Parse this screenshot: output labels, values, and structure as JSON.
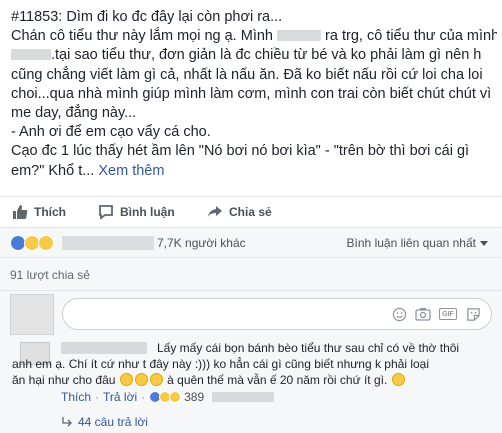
{
  "post": {
    "lines": [
      [
        "#11853: Dìm đi ko đc đây lại còn phơi ra..."
      ],
      [
        "Chán cô tiểu thư này lắm mọi ng ạ. Mình",
        "ra trg, cô tiểu thư của mình"
      ],
      [
        "",
        ".tại sao tiểu thư, đơn giản là đc chiều từ bé và ko phải làm gì nên h"
      ],
      [
        "cũng chẳng viết làm gì cả, nhất là nấu ăn. Đã ko biết nấu rồi cứ loi cha loi"
      ],
      [
        "choi...qua nhà mình giúp mình làm cơm, mình con trai còn biết chút chút vì"
      ],
      [
        "me day, đẳng này..."
      ],
      [
        "- Anh ơi để em cạo vẩy cá cho."
      ],
      [
        "Cạo đc 1 lúc thấy hét ầm lên \"Nó bơi nó bơi kìa\" - \"trên bờ thì bơi cái gì"
      ],
      [
        "em?\" Khổ t..."
      ]
    ],
    "see_more": "Xem thêm"
  },
  "actions": {
    "like": "Thích",
    "comment": "Bình luận",
    "share": "Chia sẻ"
  },
  "reactions": {
    "count_text": "7,7K người khác",
    "order_label": "Bình luận liên quan nhất"
  },
  "shares": {
    "text": "91 lượt chia sẻ"
  },
  "composer": {
    "icons": [
      "emoji-icon",
      "camera-icon",
      "gif-icon",
      "sticker-icon"
    ],
    "gif_label": "GIF"
  },
  "comment": {
    "line1": "Lấy mấy cái bọn bánh bèo tiểu thư sau chỉ có về thờ thôi",
    "line2": "anh em ạ. Chí ít cứ như t đây này :))) ko hẳn cái gì cũng biết nhưng k phải loại",
    "line3a": "ăn hại như cho đâu",
    "line3b": "à quên thế mà vẫn ế 20 năm rồi chứ ít gì.",
    "like": "Thích",
    "reply": "Trả lời",
    "reaction_count": "389"
  },
  "replies": {
    "text": "44 câu trả lời"
  },
  "colors": {
    "link": "#365899",
    "like_blue": "#4c7bd8",
    "emoji_yellow": "#f7c948"
  }
}
